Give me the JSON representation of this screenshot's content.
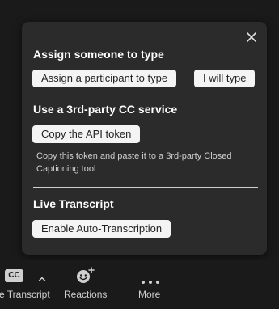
{
  "popup": {
    "assign_section": {
      "title": "Assign someone to type",
      "assign_participant_label": "Assign a participant to type",
      "i_will_type_label": "I will type"
    },
    "third_party_section": {
      "title": "Use a 3rd-party CC service",
      "copy_token_label": "Copy the API token",
      "helper_text": "Copy this token and paste it to a 3rd-party Closed Captioning tool"
    },
    "live_transcript_section": {
      "title": "Live Transcript",
      "enable_label": "Enable Auto-Transcription"
    }
  },
  "toolbar": {
    "items": [
      {
        "label": "e Transcript",
        "icon": "cc-icon",
        "icon_text": "CC"
      },
      {
        "label": "Reactions",
        "icon": "reactions-icon"
      },
      {
        "label": "More",
        "icon": "more-icon"
      }
    ]
  },
  "colors": {
    "background": "#1a1a1a",
    "popup": "#2b2b2b",
    "button": "#f4f4f4",
    "text": "#ffffff"
  }
}
